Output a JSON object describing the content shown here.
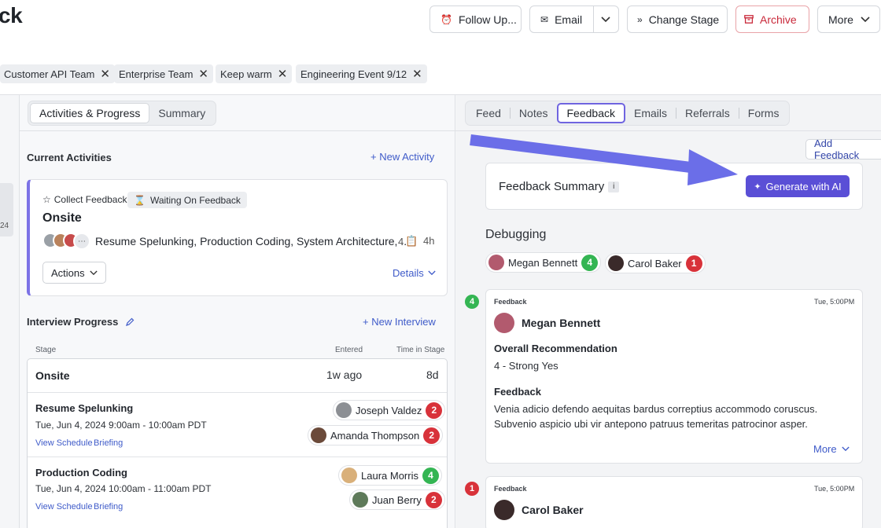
{
  "header": {
    "title": "ck",
    "buttons": {
      "follow_up": "Follow Up...",
      "email": "Email",
      "change_stage": "Change Stage",
      "archive": "Archive",
      "more": "More"
    },
    "tags": [
      "Customer API Team",
      "Enterprise Team",
      "Keep warm",
      "Engineering Event 9/12"
    ]
  },
  "sidebar_strip_text": "24",
  "left_tabs": [
    "Activities & Progress",
    "Summary"
  ],
  "current_activities": {
    "heading": "Current Activities",
    "new_activity": "New Activity",
    "card": {
      "type_label": "Collect Feedback",
      "status_pill": "Waiting On Feedback",
      "title": "Onsite",
      "interviews": "Resume Spelunking, Production Coding, System Architecture, ...",
      "count": "4",
      "duration": "4h",
      "actions": "Actions",
      "details": "Details"
    }
  },
  "interview_progress": {
    "heading": "Interview Progress",
    "new_interview": "New Interview",
    "columns": {
      "stage": "Stage",
      "entered": "Entered",
      "time_in_stage": "Time in Stage"
    },
    "stage_row": {
      "stage": "Onsite",
      "entered": "1w ago",
      "time": "8d"
    },
    "interviews": [
      {
        "name": "Resume Spelunking",
        "date": "Tue, Jun 4, 2024 9:00am - 10:00am PDT",
        "view_schedule": "View Schedule",
        "briefing": "Briefing",
        "interviewers": [
          {
            "name": "Joseph Valdez",
            "score": "2",
            "color": "#d8323a"
          },
          {
            "name": "Amanda Thompson",
            "score": "2",
            "color": "#d8323a"
          }
        ]
      },
      {
        "name": "Production Coding",
        "date": "Tue, Jun 4, 2024 10:00am - 11:00am PDT",
        "view_schedule": "View Schedule",
        "briefing": "Briefing",
        "interviewers": [
          {
            "name": "Laura Morris",
            "score": "4",
            "color": "#34b553"
          },
          {
            "name": "Juan Berry",
            "score": "2",
            "color": "#d8323a"
          }
        ]
      }
    ]
  },
  "right_tabs": [
    "Feed",
    "Notes",
    "Feedback",
    "Emails",
    "Referrals",
    "Forms"
  ],
  "add_feedback": "Add Feedback",
  "feedback_summary": {
    "title": "Feedback Summary",
    "info": "i",
    "generate": "Generate with AI"
  },
  "debugging": {
    "heading": "Debugging",
    "people": [
      {
        "name": "Megan Bennett",
        "score": "4",
        "color": "#34b553"
      },
      {
        "name": "Carol Baker",
        "score": "1",
        "color": "#d8323a"
      }
    ]
  },
  "feedback_cards": [
    {
      "badge": "4",
      "label": "Feedback",
      "time": "Tue, 5:00PM",
      "name": "Megan Bennett",
      "rec_heading": "Overall Recommendation",
      "rec_value": "4 - Strong Yes",
      "fb_heading": "Feedback",
      "fb_text_1": "Venia adicio defendo aequitas bardus correptius accommodo coruscus.",
      "fb_text_2": "Subvenio aspicio ubi vir antepono patruus temeritas patrocinor asper.",
      "more": "More"
    },
    {
      "badge": "1",
      "label": "Feedback",
      "time": "Tue, 5:00PM",
      "name": "Carol Baker"
    }
  ],
  "colors": {
    "accent": "#5a4fd6",
    "arrow": "#6b6ee8",
    "green": "#34b553",
    "red": "#d8323a"
  },
  "icons": {
    "follow_up": "alarm-clock-icon",
    "email": "envelope-icon",
    "change_stage": "double-chevron-right-icon",
    "archive": "archive-box-icon",
    "annotation": "arrow-annotation"
  }
}
